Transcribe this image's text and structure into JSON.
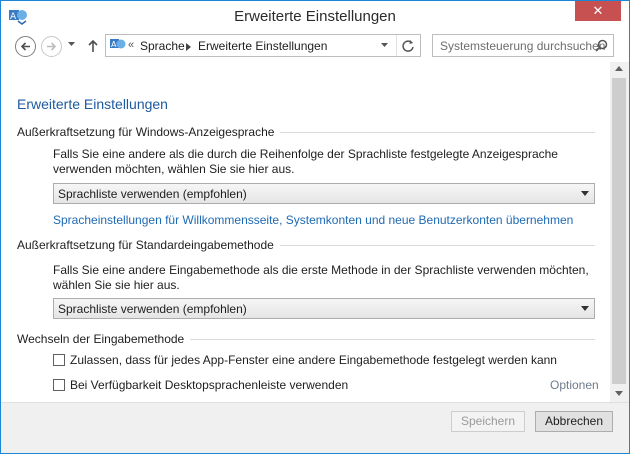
{
  "window": {
    "title": "Erweiterte Einstellungen",
    "close_glyph": "✕"
  },
  "nav": {
    "breadcrumb": [
      "Sprache",
      "Erweiterte Einstellungen"
    ],
    "breadcrumb_prefix": "«",
    "search_placeholder": "Systemsteuerung durchsuchen"
  },
  "page": {
    "title": "Erweiterte Einstellungen",
    "sections": [
      {
        "header": "Außerkraftsetzung für Windows-Anzeigesprache",
        "description": "Falls Sie eine andere als die durch die Reihenfolge der Sprachliste festgelegte Anzeigesprache verwenden möchten, wählen Sie sie hier aus.",
        "select_value": "Sprachliste verwenden (empfohlen)",
        "link": "Spracheinstellungen für Willkommensseite, Systemkonten und neue Benutzerkonten übernehmen"
      },
      {
        "header": "Außerkraftsetzung für Standardeingabemethode",
        "description": "Falls Sie eine andere Eingabemethode als die erste Methode in der Sprachliste verwenden möchten, wählen Sie sie hier aus.",
        "select_value": "Sprachliste verwenden (empfohlen)"
      },
      {
        "header": "Wechseln der Eingabemethode",
        "checkboxes": [
          {
            "label": "Zulassen, dass für jedes App-Fenster eine andere Eingabemethode festgelegt werden kann",
            "checked": false
          },
          {
            "label": "Bei Verfügbarkeit Desktopsprachenleiste verwenden",
            "checked": false
          }
        ],
        "options_link": "Optionen"
      }
    ]
  },
  "footer": {
    "save_label": "Speichern",
    "cancel_label": "Abbrechen"
  },
  "colors": {
    "accent": "#1e5aa0",
    "link": "#1e6ab4",
    "close": "#c75050"
  },
  "icons": {
    "app": "language-icon",
    "back": "back-arrow-icon",
    "forward": "forward-arrow-icon",
    "up": "up-arrow-icon",
    "refresh": "refresh-icon",
    "search": "search-icon"
  }
}
